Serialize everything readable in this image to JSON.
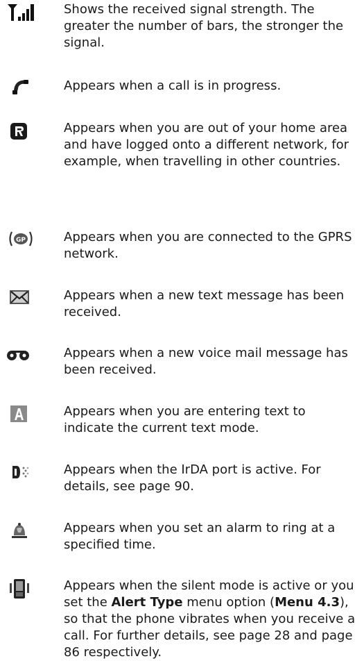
{
  "entries": [
    {
      "icon": "signal-strength-icon",
      "text": "Shows the received signal strength. The greater the number of bars, the stronger the signal."
    },
    {
      "icon": "call-in-progress-icon",
      "text": "Appears when a call is in progress."
    },
    {
      "icon": "roaming-icon",
      "text": "Appears when you are out of your home area and have logged onto a different network, for example, when travelling in other countries."
    },
    {
      "icon": "gprs-icon",
      "text": "Appears when you are connected to the GPRS network."
    },
    {
      "icon": "new-message-icon",
      "text": "Appears when a new text message has been received."
    },
    {
      "icon": "voice-mail-icon",
      "text": "Appears when a new voice mail message has been received."
    },
    {
      "icon": "text-mode-icon",
      "text": "Appears when you are entering text to indicate the current text mode."
    },
    {
      "icon": "irda-port-icon",
      "text": "Appears when the IrDA port is active. For details, see page 90."
    },
    {
      "icon": "alarm-icon",
      "text": "Appears when you set an alarm to ring at a specified time."
    },
    {
      "icon": "vibration-icon",
      "text_parts": {
        "p1": "Appears when the silent mode is active or you set the ",
        "alert_type": "Alert Type",
        "p2": " menu option (",
        "menu": "Menu 4.3",
        "p3": "), so that the phone vibrates when you receive a call. For further details, see page 28 and page 86 respectively."
      }
    }
  ]
}
